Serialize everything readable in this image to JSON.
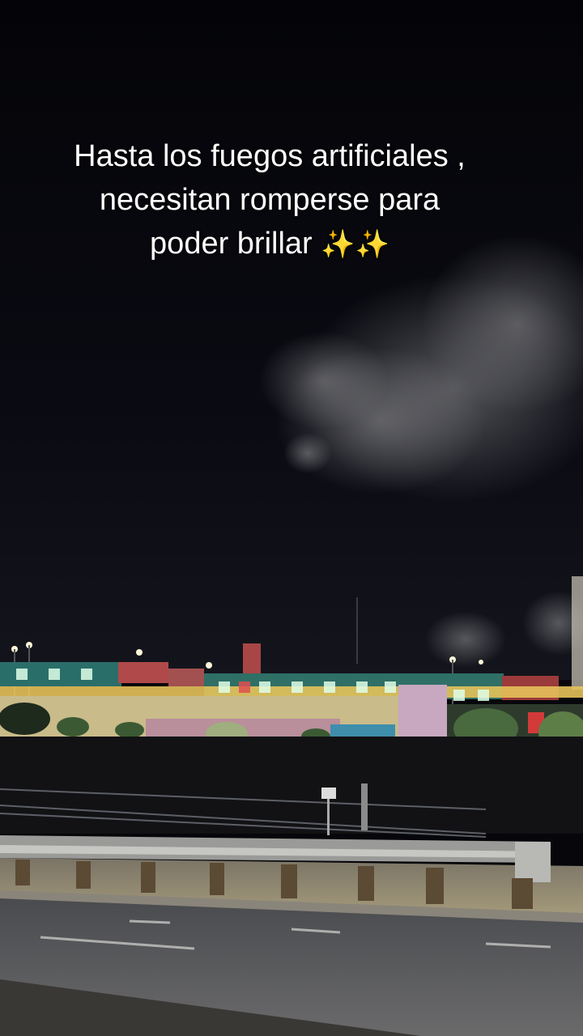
{
  "caption": {
    "line1": "Hasta los fuegos artificiales ,",
    "line2": "necesitan romperse para",
    "line3": "poder brillar",
    "emoji": "✨✨"
  },
  "colors": {
    "sky": "#07070b",
    "smoke": "#9a9a9a",
    "building_lights": "#f2d36b",
    "road": "#5a5b5e"
  }
}
